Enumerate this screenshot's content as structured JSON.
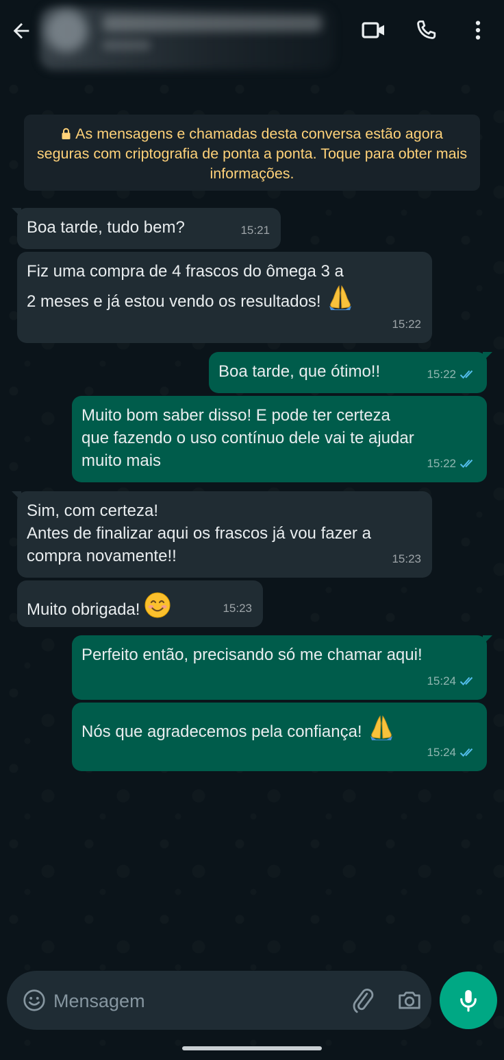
{
  "header": {
    "back_icon": "arrow-left-icon",
    "contact_name": "",
    "video_icon": "video-camera-icon",
    "call_icon": "phone-icon",
    "menu_icon": "more-vertical-icon"
  },
  "notice": {
    "text": "As mensagens e chamadas desta conversa estão agora seguras com criptografia de ponta a ponta. Toque para obter mais informações.",
    "color": "#ffd279"
  },
  "messages": [
    {
      "direction": "in",
      "text": "Boa tarde, tudo bem?",
      "time": "15:21"
    },
    {
      "direction": "in",
      "text": "Fiz uma compra de 4 frascos do ômega 3 a\n2 meses e já estou vendo os resultados!",
      "emoji": "🙏",
      "time": "15:22"
    },
    {
      "direction": "out",
      "text": "Boa tarde, que ótimo!!",
      "time": "15:22",
      "status": "read"
    },
    {
      "direction": "out",
      "text": "Muito bom saber disso! E pode ter certeza\nque fazendo o uso contínuo dele vai te ajudar\nmuito mais",
      "time": "15:22",
      "status": "read"
    },
    {
      "direction": "in",
      "text": "Sim, com certeza!\nAntes de finalizar aqui os frascos já vou fazer a\ncompra novamente!!",
      "time": "15:23"
    },
    {
      "direction": "in",
      "text": "Muito obrigada!",
      "emoji": "😊",
      "time": "15:23"
    },
    {
      "direction": "out",
      "text": "Perfeito então, precisando só me chamar aqui!",
      "time": "15:24",
      "status": "read"
    },
    {
      "direction": "out",
      "text": "Nós que agradecemos pela confiança!",
      "emoji": "🙏",
      "time": "15:24",
      "status": "read"
    }
  ],
  "composer": {
    "placeholder": "Mensagem",
    "emoji_icon": "smiley-icon",
    "attach_icon": "paperclip-icon",
    "camera_icon": "camera-icon",
    "mic_icon": "microphone-icon"
  },
  "colors": {
    "background": "#0b141a",
    "incoming_bubble": "#202c33",
    "outgoing_bubble": "#005c4b",
    "read_tick": "#53bdeb",
    "accent": "#00a884"
  }
}
